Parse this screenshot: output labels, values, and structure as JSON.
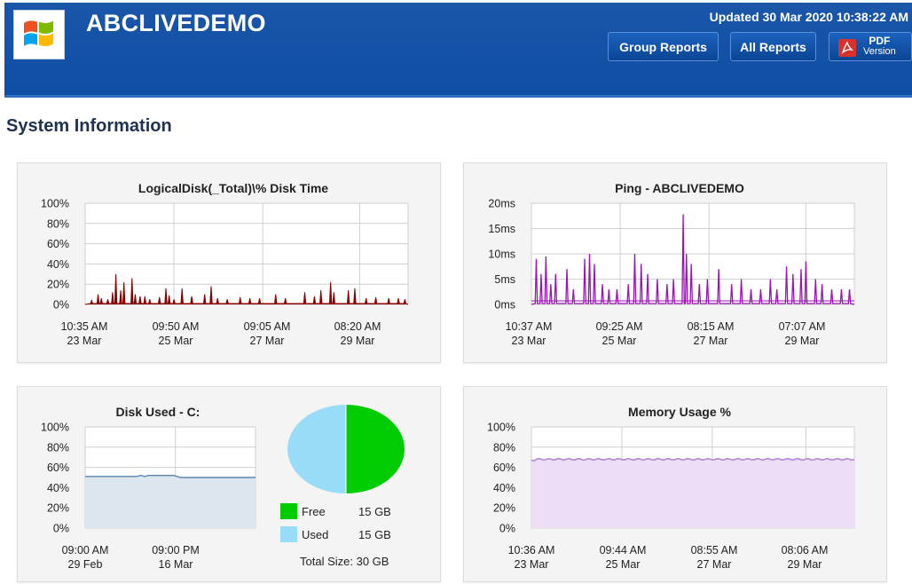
{
  "header": {
    "title": "ABCLIVEDEMO",
    "updated": "Updated 30 Mar 2020 10:38:22 AM",
    "group_reports_label": "Group Reports",
    "all_reports_label": "All Reports",
    "pdf_label": "PDF",
    "pdf_sub_label": "Version",
    "logo_icon": "windows-logo-icon",
    "background_color": "#0f4ea6"
  },
  "section_title": "System Information",
  "panels": {
    "disk_time": {
      "title": "LogicalDisk(_Total)\\% Disk Time",
      "y_ticks": [
        "100%",
        "80%",
        "60%",
        "40%",
        "20%",
        "0%"
      ],
      "x_ticks": [
        {
          "time": "10:35 AM",
          "date": "23 Mar"
        },
        {
          "time": "09:50 AM",
          "date": "25 Mar"
        },
        {
          "time": "09:05 AM",
          "date": "27 Mar"
        },
        {
          "time": "08:20 AM",
          "date": "29 Mar"
        }
      ],
      "color": "#8b0000"
    },
    "ping": {
      "title": "Ping - ABCLIVEDEMO",
      "y_ticks": [
        "20ms",
        "15ms",
        "10ms",
        "5ms",
        "0ms"
      ],
      "x_ticks": [
        {
          "time": "10:37 AM",
          "date": "23 Mar"
        },
        {
          "time": "09:25 AM",
          "date": "25 Mar"
        },
        {
          "time": "08:15 AM",
          "date": "27 Mar"
        },
        {
          "time": "07:07 AM",
          "date": "29 Mar"
        }
      ],
      "color": "#9a13b6"
    },
    "disk_used": {
      "title": "Disk Used - C:",
      "y_ticks": [
        "100%",
        "80%",
        "60%",
        "40%",
        "20%",
        "0%"
      ],
      "x_ticks": [
        {
          "time": "09:00 AM",
          "date": "29 Feb"
        },
        {
          "time": "09:00 PM",
          "date": "16 Mar"
        }
      ],
      "legend": [
        {
          "label": "Free",
          "value": "15 GB",
          "color": "#00cc00"
        },
        {
          "label": "Used",
          "value": "15 GB",
          "color": "#99dcf7"
        }
      ],
      "total": "Total Size: 30 GB",
      "used_fraction": 0.5,
      "line_color": "#5a86b3",
      "fill_color": "#dce6ee"
    },
    "memory": {
      "title": "Memory Usage %",
      "y_ticks": [
        "100%",
        "80%",
        "60%",
        "40%",
        "20%",
        "0%"
      ],
      "x_ticks": [
        {
          "time": "10:36 AM",
          "date": "23 Mar"
        },
        {
          "time": "09:44 AM",
          "date": "25 Mar"
        },
        {
          "time": "08:55 AM",
          "date": "27 Mar"
        },
        {
          "time": "08:06 AM",
          "date": "29 Mar"
        }
      ],
      "line_color": "#b287d9",
      "fill_color": "#ecdff5",
      "level_percent": 68
    }
  },
  "chart_data": [
    {
      "type": "area",
      "title": "LogicalDisk(_Total)\\% Disk Time",
      "ylim": [
        0,
        100
      ],
      "x": [
        "10:35 AM 23 Mar",
        "09:50 AM 25 Mar",
        "09:05 AM 27 Mar",
        "08:20 AM 29 Mar"
      ],
      "spikes": [
        {
          "t": 0.02,
          "v": 4
        },
        {
          "t": 0.04,
          "v": 10
        },
        {
          "t": 0.05,
          "v": 6
        },
        {
          "t": 0.07,
          "v": 5
        },
        {
          "t": 0.085,
          "v": 12
        },
        {
          "t": 0.095,
          "v": 30
        },
        {
          "t": 0.11,
          "v": 14
        },
        {
          "t": 0.12,
          "v": 22
        },
        {
          "t": 0.145,
          "v": 26
        },
        {
          "t": 0.155,
          "v": 10
        },
        {
          "t": 0.17,
          "v": 8
        },
        {
          "t": 0.185,
          "v": 8
        },
        {
          "t": 0.2,
          "v": 5
        },
        {
          "t": 0.23,
          "v": 7
        },
        {
          "t": 0.25,
          "v": 16
        },
        {
          "t": 0.26,
          "v": 9
        },
        {
          "t": 0.275,
          "v": 5
        },
        {
          "t": 0.3,
          "v": 16
        },
        {
          "t": 0.33,
          "v": 8
        },
        {
          "t": 0.37,
          "v": 10
        },
        {
          "t": 0.39,
          "v": 18
        },
        {
          "t": 0.41,
          "v": 6
        },
        {
          "t": 0.44,
          "v": 5
        },
        {
          "t": 0.48,
          "v": 7
        },
        {
          "t": 0.51,
          "v": 6
        },
        {
          "t": 0.54,
          "v": 6
        },
        {
          "t": 0.59,
          "v": 10
        },
        {
          "t": 0.62,
          "v": 6
        },
        {
          "t": 0.68,
          "v": 12
        },
        {
          "t": 0.71,
          "v": 8
        },
        {
          "t": 0.73,
          "v": 14
        },
        {
          "t": 0.76,
          "v": 22
        },
        {
          "t": 0.77,
          "v": 12
        },
        {
          "t": 0.815,
          "v": 14
        },
        {
          "t": 0.835,
          "v": 16
        },
        {
          "t": 0.87,
          "v": 6
        },
        {
          "t": 0.9,
          "v": 7
        },
        {
          "t": 0.94,
          "v": 6
        },
        {
          "t": 0.97,
          "v": 6
        },
        {
          "t": 0.99,
          "v": 5
        }
      ]
    },
    {
      "type": "area",
      "title": "Ping - ABCLIVEDEMO",
      "ylim": [
        0,
        20
      ],
      "unit": "ms",
      "x": [
        "10:37 AM 23 Mar",
        "09:25 AM 25 Mar",
        "08:15 AM 27 Mar",
        "07:07 AM 29 Mar"
      ],
      "spikes": [
        {
          "t": 0.015,
          "v": 9
        },
        {
          "t": 0.03,
          "v": 6
        },
        {
          "t": 0.045,
          "v": 9.5
        },
        {
          "t": 0.06,
          "v": 4
        },
        {
          "t": 0.075,
          "v": 6
        },
        {
          "t": 0.11,
          "v": 7
        },
        {
          "t": 0.13,
          "v": 3
        },
        {
          "t": 0.165,
          "v": 9
        },
        {
          "t": 0.18,
          "v": 10
        },
        {
          "t": 0.195,
          "v": 8
        },
        {
          "t": 0.22,
          "v": 4
        },
        {
          "t": 0.24,
          "v": 3
        },
        {
          "t": 0.265,
          "v": 3
        },
        {
          "t": 0.3,
          "v": 4
        },
        {
          "t": 0.32,
          "v": 10
        },
        {
          "t": 0.34,
          "v": 8
        },
        {
          "t": 0.36,
          "v": 6
        },
        {
          "t": 0.39,
          "v": 5
        },
        {
          "t": 0.42,
          "v": 4
        },
        {
          "t": 0.44,
          "v": 5
        },
        {
          "t": 0.47,
          "v": 17.8
        },
        {
          "t": 0.48,
          "v": 10
        },
        {
          "t": 0.495,
          "v": 8
        },
        {
          "t": 0.52,
          "v": 4
        },
        {
          "t": 0.545,
          "v": 5
        },
        {
          "t": 0.58,
          "v": 7
        },
        {
          "t": 0.62,
          "v": 4
        },
        {
          "t": 0.65,
          "v": 5
        },
        {
          "t": 0.68,
          "v": 3
        },
        {
          "t": 0.71,
          "v": 3
        },
        {
          "t": 0.74,
          "v": 5
        },
        {
          "t": 0.76,
          "v": 3
        },
        {
          "t": 0.79,
          "v": 7.5
        },
        {
          "t": 0.81,
          "v": 6
        },
        {
          "t": 0.835,
          "v": 7
        },
        {
          "t": 0.85,
          "v": 8.5
        },
        {
          "t": 0.88,
          "v": 5
        },
        {
          "t": 0.9,
          "v": 4
        },
        {
          "t": 0.93,
          "v": 3
        },
        {
          "t": 0.96,
          "v": 3
        },
        {
          "t": 0.985,
          "v": 3
        }
      ]
    },
    {
      "type": "area",
      "title": "Disk Used - C:",
      "ylim": [
        0,
        100
      ],
      "x": [
        "09:00 AM 29 Feb",
        "09:00 PM 16 Mar"
      ],
      "points": [
        {
          "t": 0.0,
          "v": 51
        },
        {
          "t": 0.3,
          "v": 51
        },
        {
          "t": 0.33,
          "v": 52
        },
        {
          "t": 0.35,
          "v": 51
        },
        {
          "t": 0.37,
          "v": 52
        },
        {
          "t": 0.52,
          "v": 52
        },
        {
          "t": 0.56,
          "v": 50
        },
        {
          "t": 1.0,
          "v": 50
        }
      ]
    },
    {
      "type": "pie",
      "title": "Disk Used - C:",
      "slices": [
        {
          "label": "Free",
          "value": 15,
          "unit": "GB"
        },
        {
          "label": "Used",
          "value": 15,
          "unit": "GB"
        }
      ]
    },
    {
      "type": "area",
      "title": "Memory Usage %",
      "ylim": [
        0,
        100
      ],
      "x": [
        "10:36 AM 23 Mar",
        "09:44 AM 25 Mar",
        "08:55 AM 27 Mar",
        "08:06 AM 29 Mar"
      ],
      "level": 68
    }
  ]
}
